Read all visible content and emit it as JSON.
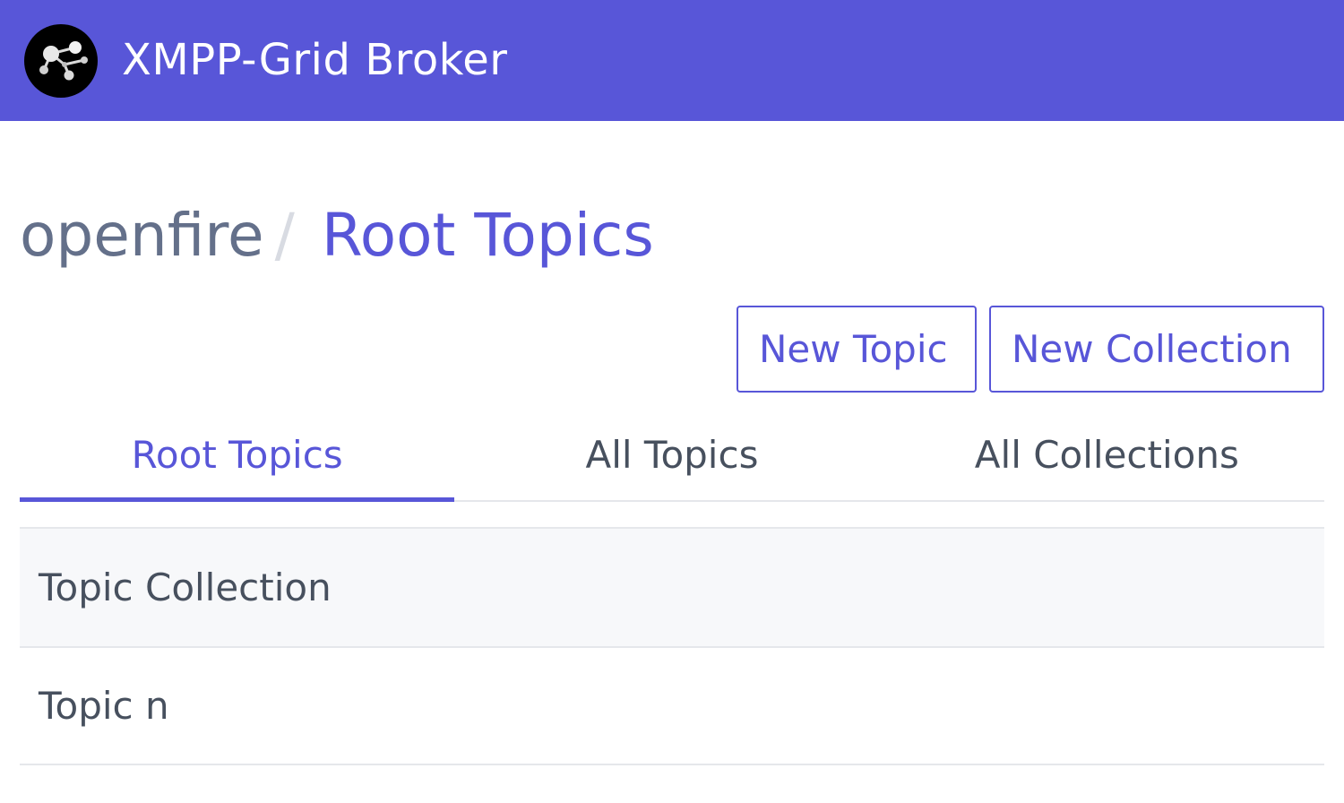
{
  "header": {
    "app_title": "XMPP-Grid Broker",
    "brand_color": "#5856d8",
    "logo_icon": "molecule-network-icon"
  },
  "breadcrumb": {
    "root": "openfire",
    "separator": "/",
    "current": "Root Topics"
  },
  "actions": {
    "new_topic": "New Topic",
    "new_collection": "New Collection"
  },
  "tabs": [
    {
      "label": "Root Topics",
      "active": true
    },
    {
      "label": "All Topics",
      "active": false
    },
    {
      "label": "All Collections",
      "active": false
    }
  ],
  "list": {
    "items": [
      {
        "label": "Topic Collection"
      },
      {
        "label": "Topic n"
      }
    ]
  }
}
